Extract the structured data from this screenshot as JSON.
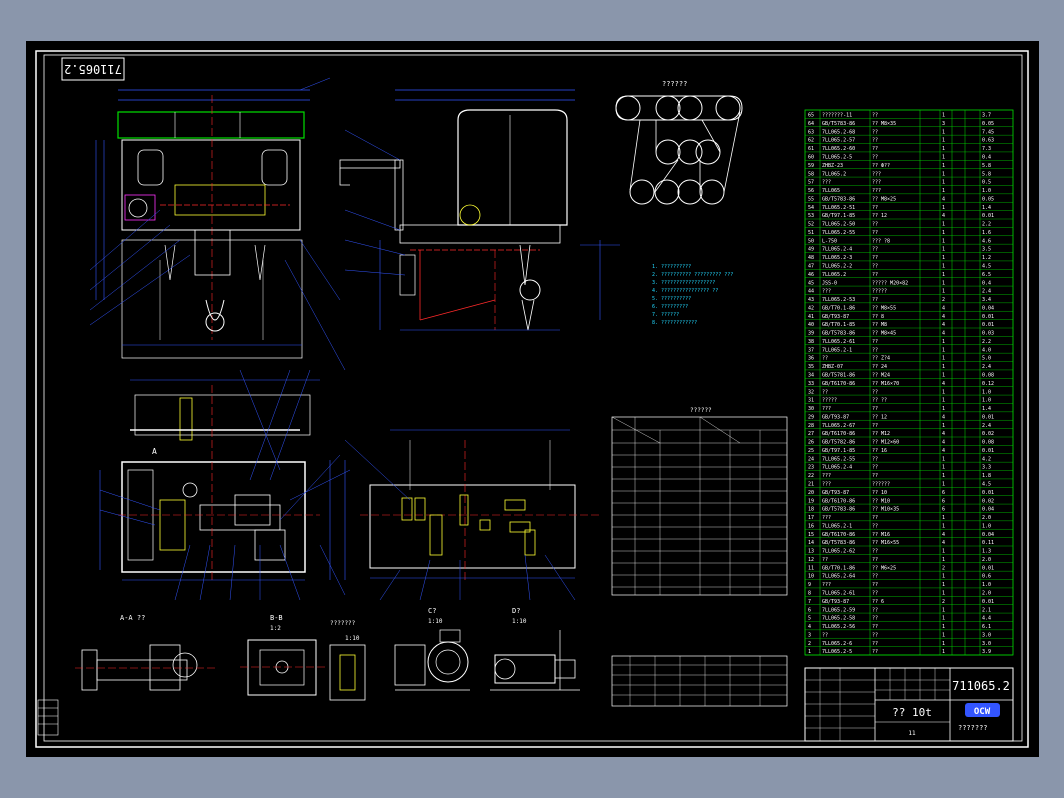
{
  "drawing": {
    "number_mirrored": "711065.2",
    "number": "711065.2",
    "product": "?? 10t",
    "company_logo": "OCW",
    "company_name": "???????",
    "sheet_label": "11",
    "pulley_diagram_title": "??????"
  },
  "section_labels": {
    "section_aa": "A-A ??",
    "section_bb": "B-B",
    "scale_bb": "1:2",
    "view_c": "C?",
    "scale_c": "1:10",
    "view_d": "D?",
    "scale_d": "1:10",
    "view_other": "???????",
    "scale_other": "1:10",
    "view_a": "A"
  },
  "parts_list": {
    "rows": [
      [
        "65",
        "???????-11",
        "??",
        "1",
        "3.7"
      ],
      [
        "64",
        "GB/T5783-86",
        "?? M8×35",
        "3",
        "0.05"
      ],
      [
        "63",
        "7LL065.2-68",
        "??",
        "1",
        "7.45"
      ],
      [
        "62",
        "7LL065.2-57",
        "??",
        "1",
        "0.63"
      ],
      [
        "61",
        "7LL065.2-60",
        "??",
        "1",
        "7.3"
      ],
      [
        "60",
        "7LL065.2-5",
        "??",
        "1",
        "0.4"
      ],
      [
        "59",
        "ZHBZ-23",
        "?? Ф??",
        "1",
        "5.8"
      ],
      [
        "58",
        "7LL065.2",
        "???",
        "1",
        "5.8"
      ],
      [
        "57",
        "???",
        "???",
        "1",
        "0.5"
      ],
      [
        "56",
        "7LL065",
        "???",
        "1",
        "1.0"
      ],
      [
        "55",
        "GB/T5783-86",
        "?? M8×25",
        "4",
        "0.05"
      ],
      [
        "54",
        "7LL065.2-51",
        "??",
        "1",
        "1.4"
      ],
      [
        "53",
        "GB/T97.1-85",
        "?? 12",
        "4",
        "0.01"
      ],
      [
        "52",
        "7LL065.2-50",
        "??",
        "1",
        "2.2"
      ],
      [
        "51",
        "7LL065.2-55",
        "??",
        "1",
        "1.6"
      ],
      [
        "50",
        "L-750",
        "??? ?8",
        "1",
        "4.6"
      ],
      [
        "49",
        "7LL065.2-4",
        "??",
        "1",
        "3.5"
      ],
      [
        "48",
        "7LL065.2-3",
        "??",
        "1",
        "1.2"
      ],
      [
        "47",
        "7LL065.2-2",
        "??",
        "1",
        "4.5"
      ],
      [
        "46",
        "7LL065.2",
        "??",
        "1",
        "6.5"
      ],
      [
        "45",
        "JSS-0",
        "????? M20×82",
        "1",
        "0.4"
      ],
      [
        "44",
        "???",
        "?????",
        "1",
        "2.4"
      ],
      [
        "43",
        "7LL065.2-53",
        "??",
        "2",
        "3.4"
      ],
      [
        "42",
        "GB/T70.1-86",
        "?? M8×55",
        "4",
        "0.04"
      ],
      [
        "41",
        "GB/T93-87",
        "?? 8",
        "4",
        "0.01"
      ],
      [
        "40",
        "GB/T70.1-85",
        "?? M8",
        "4",
        "0.01"
      ],
      [
        "39",
        "GB/T5783-86",
        "?? M8×45",
        "4",
        "0.03"
      ],
      [
        "38",
        "7LL065.2-61",
        "??",
        "1",
        "2.2"
      ],
      [
        "37",
        "7LL065.2-1",
        "??",
        "1",
        "4.0"
      ],
      [
        "36",
        "??",
        "?? Z?4",
        "1",
        "5.0"
      ],
      [
        "35",
        "ZHBZ-07",
        "?? 24",
        "1",
        "2.4"
      ],
      [
        "34",
        "GB/T5781-86",
        "?? M24",
        "1",
        "0.08"
      ],
      [
        "33",
        "GB/T6170-86",
        "?? M16×70",
        "4",
        "0.12"
      ],
      [
        "32",
        "??",
        "??",
        "1",
        "1.0"
      ],
      [
        "31",
        "?????",
        "?? ??",
        "1",
        "1.0"
      ],
      [
        "30",
        "???",
        "??",
        "1",
        "1.4"
      ],
      [
        "29",
        "GB/T93-87",
        "?? 12",
        "4",
        "0.01"
      ],
      [
        "28",
        "7LL065.2-67",
        "??",
        "1",
        "2.4"
      ],
      [
        "27",
        "GB/T6170-86",
        "?? M12",
        "4",
        "0.02"
      ],
      [
        "26",
        "GB/T5782-86",
        "?? M12×60",
        "4",
        "0.08"
      ],
      [
        "25",
        "GB/T97.1-85",
        "?? 16",
        "4",
        "0.01"
      ],
      [
        "24",
        "7LL065.2-55",
        "??",
        "1",
        "4.2"
      ],
      [
        "23",
        "7LL065.2-4",
        "??",
        "1",
        "3.3"
      ],
      [
        "22",
        "???",
        "??",
        "1",
        "1.8"
      ],
      [
        "21",
        "???",
        "??????",
        "1",
        "4.5"
      ],
      [
        "20",
        "GB/T93-87",
        "?? 10",
        "6",
        "0.01"
      ],
      [
        "19",
        "GB/T6170-86",
        "?? M10",
        "6",
        "0.02"
      ],
      [
        "18",
        "GB/T5783-86",
        "?? M10×35",
        "6",
        "0.04"
      ],
      [
        "17",
        "???",
        "??",
        "1",
        "2.0"
      ],
      [
        "16",
        "7LL065.2-1",
        "??",
        "1",
        "1.0"
      ],
      [
        "15",
        "GB/T6170-86",
        "?? M16",
        "4",
        "0.04"
      ],
      [
        "14",
        "GB/T5783-86",
        "?? M16×55",
        "4",
        "0.11"
      ],
      [
        "13",
        "7LL065.2-62",
        "??",
        "1",
        "1.3"
      ],
      [
        "12",
        "??",
        "??",
        "1",
        "2.0"
      ],
      [
        "11",
        "GB/T70.1-86",
        "?? M6×25",
        "2",
        "0.01"
      ],
      [
        "10",
        "7LL065.2-64",
        "??",
        "1",
        "0.6"
      ],
      [
        "9",
        "???",
        "??",
        "1",
        "1.0"
      ],
      [
        "8",
        "7LL065.2-61",
        "??",
        "1",
        "2.0"
      ],
      [
        "7",
        "GB/T93-87",
        "?? 6",
        "2",
        "0.01"
      ],
      [
        "6",
        "7LL065.2-59",
        "??",
        "1",
        "2.1"
      ],
      [
        "5",
        "7LL065.2-58",
        "??",
        "1",
        "4.4"
      ],
      [
        "4",
        "7LL065.2-56",
        "??",
        "1",
        "6.1"
      ],
      [
        "3",
        "??",
        "??",
        "1",
        "3.0"
      ],
      [
        "2",
        "7LL065.2-6",
        "??",
        "1",
        "3.0"
      ],
      [
        "1",
        "7LL065.2-5",
        "??",
        "1",
        "3.9"
      ]
    ]
  },
  "tech_requirements": [
    "1. ??????????",
    "2. ?????????? ????????? ???",
    "3. ??????????????????",
    "4. ???????????????? ??",
    "5. ??????????",
    "6. ?????????",
    "7. ??????",
    "8. ????????????"
  ],
  "tech_params_table": {
    "title": "??????"
  },
  "colors": {
    "frame": "#ffffff",
    "bill_lines": "#00e000",
    "red": "#ff2a2a",
    "blue": "#3355ff",
    "yellow": "#ffff33",
    "cyan": "#22d8ff",
    "magenta": "#ff33ff"
  }
}
